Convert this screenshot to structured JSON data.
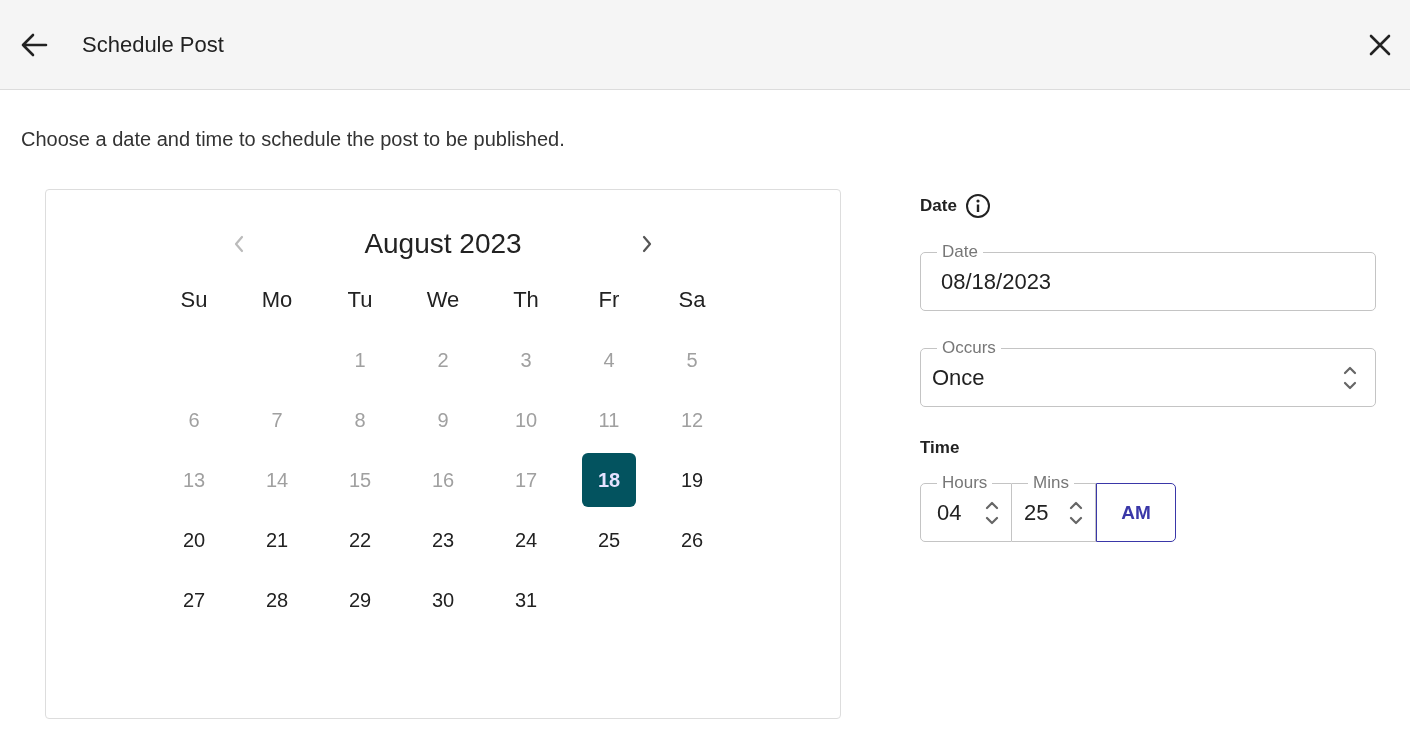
{
  "header": {
    "title": "Schedule Post"
  },
  "intro": "Choose a date and time to schedule the post to be published.",
  "calendar": {
    "month": "August 2023",
    "prev_disabled": true,
    "next_disabled": false,
    "weekdays": [
      "Su",
      "Mo",
      "Tu",
      "We",
      "Th",
      "Fr",
      "Sa"
    ],
    "weeks": [
      [
        {
          "day": "1",
          "disabled": true,
          "selected": false
        },
        {
          "day": "2",
          "disabled": true,
          "selected": false
        },
        {
          "day": "3",
          "disabled": true,
          "selected": false
        },
        {
          "day": "4",
          "disabled": true,
          "selected": false
        },
        {
          "day": "5",
          "disabled": true,
          "selected": false
        }
      ],
      [
        {
          "day": "6",
          "disabled": true,
          "selected": false
        },
        {
          "day": "7",
          "disabled": true,
          "selected": false
        },
        {
          "day": "8",
          "disabled": true,
          "selected": false
        },
        {
          "day": "9",
          "disabled": true,
          "selected": false
        },
        {
          "day": "10",
          "disabled": true,
          "selected": false
        },
        {
          "day": "11",
          "disabled": true,
          "selected": false
        },
        {
          "day": "12",
          "disabled": true,
          "selected": false
        }
      ],
      [
        {
          "day": "13",
          "disabled": true,
          "selected": false
        },
        {
          "day": "14",
          "disabled": true,
          "selected": false
        },
        {
          "day": "15",
          "disabled": true,
          "selected": false
        },
        {
          "day": "16",
          "disabled": true,
          "selected": false
        },
        {
          "day": "17",
          "disabled": true,
          "selected": false
        },
        {
          "day": "18",
          "disabled": false,
          "selected": true
        },
        {
          "day": "19",
          "disabled": false,
          "selected": false
        }
      ],
      [
        {
          "day": "20",
          "disabled": false,
          "selected": false
        },
        {
          "day": "21",
          "disabled": false,
          "selected": false
        },
        {
          "day": "22",
          "disabled": false,
          "selected": false
        },
        {
          "day": "23",
          "disabled": false,
          "selected": false
        },
        {
          "day": "24",
          "disabled": false,
          "selected": false
        },
        {
          "day": "25",
          "disabled": false,
          "selected": false
        },
        {
          "day": "26",
          "disabled": false,
          "selected": false
        }
      ],
      [
        {
          "day": "27",
          "disabled": false,
          "selected": false
        },
        {
          "day": "28",
          "disabled": false,
          "selected": false
        },
        {
          "day": "29",
          "disabled": false,
          "selected": false
        },
        {
          "day": "30",
          "disabled": false,
          "selected": false
        },
        {
          "day": "31",
          "disabled": false,
          "selected": false
        }
      ]
    ]
  },
  "date_section": {
    "label": "Date",
    "field": {
      "label": "Date",
      "value": "08/18/2023"
    }
  },
  "occurs": {
    "label": "Occurs",
    "value": "Once"
  },
  "time_section": {
    "label": "Time",
    "hours": {
      "label": "Hours",
      "value": "04"
    },
    "mins": {
      "label": "Mins",
      "value": "25"
    },
    "period": "AM"
  }
}
